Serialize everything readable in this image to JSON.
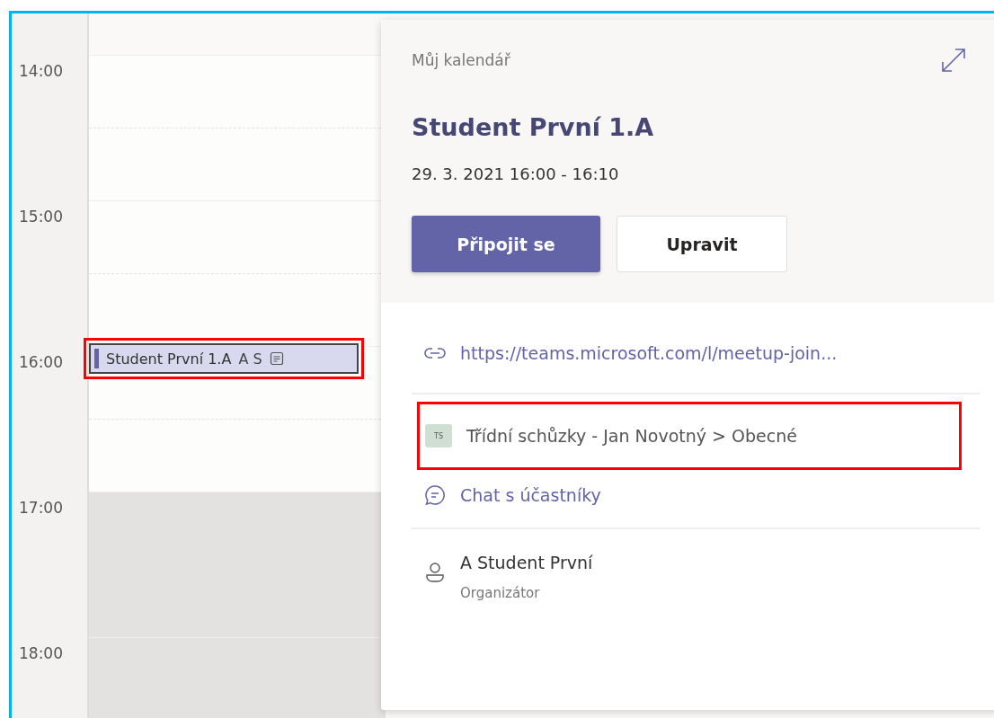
{
  "time_slots": [
    {
      "label": "14:00",
      "after_hours": false
    },
    {
      "label": "15:00",
      "after_hours": false
    },
    {
      "label": "16:00",
      "after_hours": false
    },
    {
      "label": "17:00",
      "after_hours": true
    },
    {
      "label": "18:00",
      "after_hours": true
    }
  ],
  "event": {
    "title": "Student První 1.A",
    "initials": "A S",
    "highlighted": true
  },
  "popup": {
    "calendar": "Můj kalendář",
    "title": "Student První 1.A",
    "datetime": "29. 3. 2021 16:00 - 16:10",
    "buttons": [
      {
        "label": "Připojit se",
        "kind": "primary"
      },
      {
        "label": "Upravit",
        "kind": "secondary"
      }
    ],
    "link": "https://teams.microsoft.com/l/meetup-join...",
    "channel": {
      "badge": "TS",
      "text": "Třídní schůzky - Jan Novotný > Obecné",
      "highlighted": true
    },
    "chat": "Chat s účastníky",
    "organizer": {
      "name": "A Student První",
      "role": "Organizátor"
    }
  }
}
